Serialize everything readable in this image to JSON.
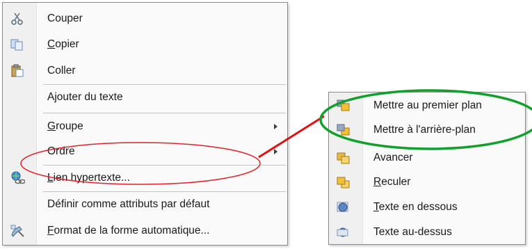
{
  "main_menu": {
    "items": [
      {
        "label": "Couper",
        "icon": "scissors-icon"
      },
      {
        "label": "Copier",
        "icon": "copy-icon"
      },
      {
        "label": "Coller",
        "icon": "paste-icon"
      },
      {
        "label": "Ajouter du texte"
      },
      {
        "label": "Groupe",
        "has_submenu": true
      },
      {
        "label": "Ordre",
        "has_submenu": true
      },
      {
        "label": "Lien hypertexte...",
        "icon": "hyperlink-icon"
      },
      {
        "label": "Définir comme attributs par défaut"
      },
      {
        "label": "Format de la forme automatique...",
        "icon": "format-shape-icon"
      }
    ]
  },
  "sub_menu": {
    "items": [
      {
        "label": "Mettre au premier plan",
        "icon": "bring-to-front-icon"
      },
      {
        "label": "Mettre à l'arrière-plan",
        "icon": "send-to-back-icon"
      },
      {
        "label": "Avancer",
        "icon": "bring-forward-icon"
      },
      {
        "label": "Reculer",
        "icon": "send-backward-icon"
      },
      {
        "label": "Texte en dessous",
        "icon": "text-behind-icon"
      },
      {
        "label": "Texte au-dessus",
        "icon": "text-in-front-icon"
      }
    ]
  },
  "colors": {
    "highlight_red": "#e0202a",
    "highlight_green": "#12a02c",
    "connector_red": "#e01010",
    "shape_yellow": "#f2c037",
    "shape_blue": "#7e95b8"
  }
}
